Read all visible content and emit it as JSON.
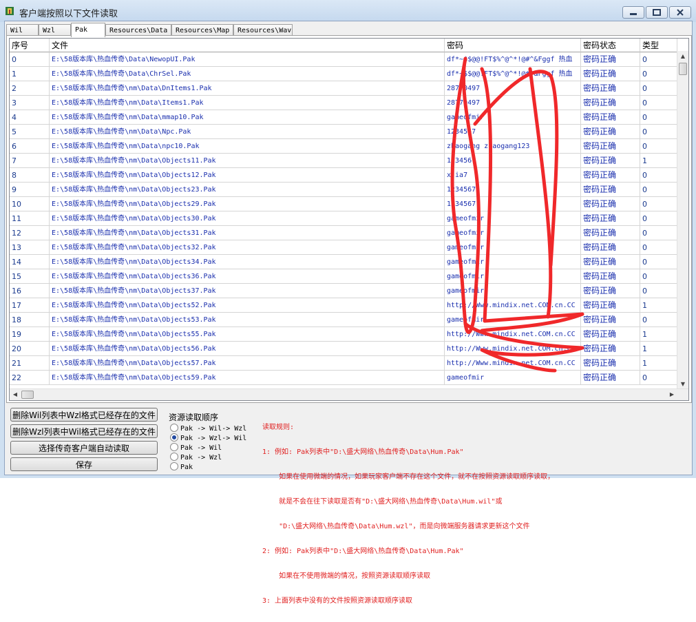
{
  "window": {
    "title": "客户端按照以下文件读取"
  },
  "tabs": [
    {
      "label": "Wil"
    },
    {
      "label": "Wzl"
    },
    {
      "label": "Pak",
      "active": true
    },
    {
      "label": "Resources\\Data"
    },
    {
      "label": "Resources\\Map"
    },
    {
      "label": "Resources\\Wav"
    }
  ],
  "grid": {
    "headers": {
      "idx": "序号",
      "file": "文件",
      "pwd": "密码",
      "status": "密码状态",
      "type": "类型"
    },
    "rows": [
      {
        "idx": "0",
        "file": "E:\\58版本库\\热血传奇\\Data\\NewopUI.Pak",
        "pwd": "  df*~$$@@!FT$%^@^*!@#^&Fggf  热血",
        "status": "密码正确",
        "type": "0"
      },
      {
        "idx": "1",
        "file": "E:\\58版本库\\热血传奇\\Data\\ChrSel.Pak",
        "pwd": "  df*~$$@@!FT$%^@^*!@#^&Fggf  热血",
        "status": "密码正确",
        "type": "0"
      },
      {
        "idx": "2",
        "file": "E:\\58版本库\\热血传奇\\nm\\Data\\DnItems1.Pak",
        "pwd": "28770497",
        "status": "密码正确",
        "type": "0"
      },
      {
        "idx": "3",
        "file": "E:\\58版本库\\热血传奇\\nm\\Data\\Items1.Pak",
        "pwd": "28770497",
        "status": "密码正确",
        "type": "0"
      },
      {
        "idx": "4",
        "file": "E:\\58版本库\\热血传奇\\nm\\Data\\mmap10.Pak",
        "pwd": "gameofmir",
        "status": "密码正确",
        "type": "0"
      },
      {
        "idx": "5",
        "file": "E:\\58版本库\\热血传奇\\nm\\Data\\Npc.Pak",
        "pwd": "1234567",
        "status": "密码正确",
        "type": "0"
      },
      {
        "idx": "6",
        "file": "E:\\58版本库\\热血传奇\\nm\\Data\\npc10.Pak",
        "pwd": "zhaogang zhaogang123",
        "status": "密码正确",
        "type": "0"
      },
      {
        "idx": "7",
        "file": "E:\\58版本库\\热血传奇\\nm\\Data\\Objects11.Pak",
        "pwd": "1234567",
        "status": "密码正确",
        "type": "1"
      },
      {
        "idx": "8",
        "file": "E:\\58版本库\\热血传奇\\nm\\Data\\Objects12.Pak",
        "pwd": "xjia7",
        "status": "密码正确",
        "type": "0"
      },
      {
        "idx": "9",
        "file": "E:\\58版本库\\热血传奇\\nm\\Data\\Objects23.Pak",
        "pwd": "1234567",
        "status": "密码正确",
        "type": "0"
      },
      {
        "idx": "10",
        "file": "E:\\58版本库\\热血传奇\\nm\\Data\\Objects29.Pak",
        "pwd": "1234567",
        "status": "密码正确",
        "type": "0"
      },
      {
        "idx": "11",
        "file": "E:\\58版本库\\热血传奇\\nm\\Data\\Objects30.Pak",
        "pwd": "gameofmir",
        "status": "密码正确",
        "type": "0"
      },
      {
        "idx": "12",
        "file": "E:\\58版本库\\热血传奇\\nm\\Data\\Objects31.Pak",
        "pwd": "gameofmir",
        "status": "密码正确",
        "type": "0"
      },
      {
        "idx": "13",
        "file": "E:\\58版本库\\热血传奇\\nm\\Data\\Objects32.Pak",
        "pwd": "gameofmir",
        "status": "密码正确",
        "type": "0"
      },
      {
        "idx": "14",
        "file": "E:\\58版本库\\热血传奇\\nm\\Data\\Objects34.Pak",
        "pwd": "gameofmir",
        "status": "密码正确",
        "type": "0"
      },
      {
        "idx": "15",
        "file": "E:\\58版本库\\热血传奇\\nm\\Data\\Objects36.Pak",
        "pwd": "gameofmir",
        "status": "密码正确",
        "type": "0"
      },
      {
        "idx": "16",
        "file": "E:\\58版本库\\热血传奇\\nm\\Data\\Objects37.Pak",
        "pwd": "gameofmir",
        "status": "密码正确",
        "type": "0"
      },
      {
        "idx": "17",
        "file": "E:\\58版本库\\热血传奇\\nm\\Data\\Objects52.Pak",
        "pwd": "http://Www.mindix.net.COM.cn.CC",
        "status": "密码正确",
        "type": "1"
      },
      {
        "idx": "18",
        "file": "E:\\58版本库\\热血传奇\\nm\\Data\\Objects53.Pak",
        "pwd": "gameofmir",
        "status": "密码正确",
        "type": "0"
      },
      {
        "idx": "19",
        "file": "E:\\58版本库\\热血传奇\\nm\\Data\\Objects55.Pak",
        "pwd": "http://Www.mindix.net.COM.cn.CC",
        "status": "密码正确",
        "type": "1"
      },
      {
        "idx": "20",
        "file": "E:\\58版本库\\热血传奇\\nm\\Data\\Objects56.Pak",
        "pwd": "http://Www.mindix.net.COM.cn.CC",
        "status": "密码正确",
        "type": "1"
      },
      {
        "idx": "21",
        "file": "E:\\58版本库\\热血传奇\\nm\\Data\\Objects57.Pak",
        "pwd": "http://Www.mindix.net.COM.cn.CC",
        "status": "密码正确",
        "type": "1"
      },
      {
        "idx": "22",
        "file": "E:\\58版本库\\热血传奇\\nm\\Data\\Objects59.Pak",
        "pwd": "gameofmir",
        "status": "密码正确",
        "type": "0"
      }
    ]
  },
  "buttons": {
    "delete_wil": "删除Wil列表中Wzl格式已经存在的文件",
    "delete_wzl": "删除Wzl列表中Wil格式已经存在的文件",
    "select_client": "选择传奇客户端自动读取",
    "save": "保存"
  },
  "read_order": {
    "title": "资源读取顺序",
    "options": [
      {
        "label": "Pak -> Wil-> Wzl",
        "checked": false
      },
      {
        "label": "Pak -> Wzl-> Wil",
        "checked": true
      },
      {
        "label": "Pak -> Wil",
        "checked": false
      },
      {
        "label": "Pak -> Wzl",
        "checked": false
      },
      {
        "label": "Pak",
        "checked": false
      }
    ]
  },
  "rules": {
    "lines": [
      "读取规则:",
      "1: 例如: Pak列表中\"D:\\盛大网络\\热血传奇\\Data\\Hum.Pak\"",
      "    如果在使用微端的情况，如果玩家客户端不存在这个文件，就不在按照资源读取顺序读取，",
      "    就是不会在往下读取是否有\"D:\\盛大网络\\热血传奇\\Data\\Hum.wil\"或",
      "    \"D:\\盛大网络\\热血传奇\\Data\\Hum.wzl\"，而是向微端服务器请求更新这个文件",
      "2: 例如: Pak列表中\"D:\\盛大网络\\热血传奇\\Data\\Hum.Pak\"",
      "    如果在不使用微端的情况，按照资源读取顺序读取",
      "3: 上面列表中没有的文件按照资源读取顺序读取"
    ]
  },
  "colors": {
    "scribble": "#f0282a",
    "link_text": "#1a2fae",
    "rules_text": "#e02020"
  },
  "icons": {
    "app": "app-icon",
    "minimize": "minimize-icon",
    "maximize": "maximize-icon",
    "close": "close-icon"
  }
}
